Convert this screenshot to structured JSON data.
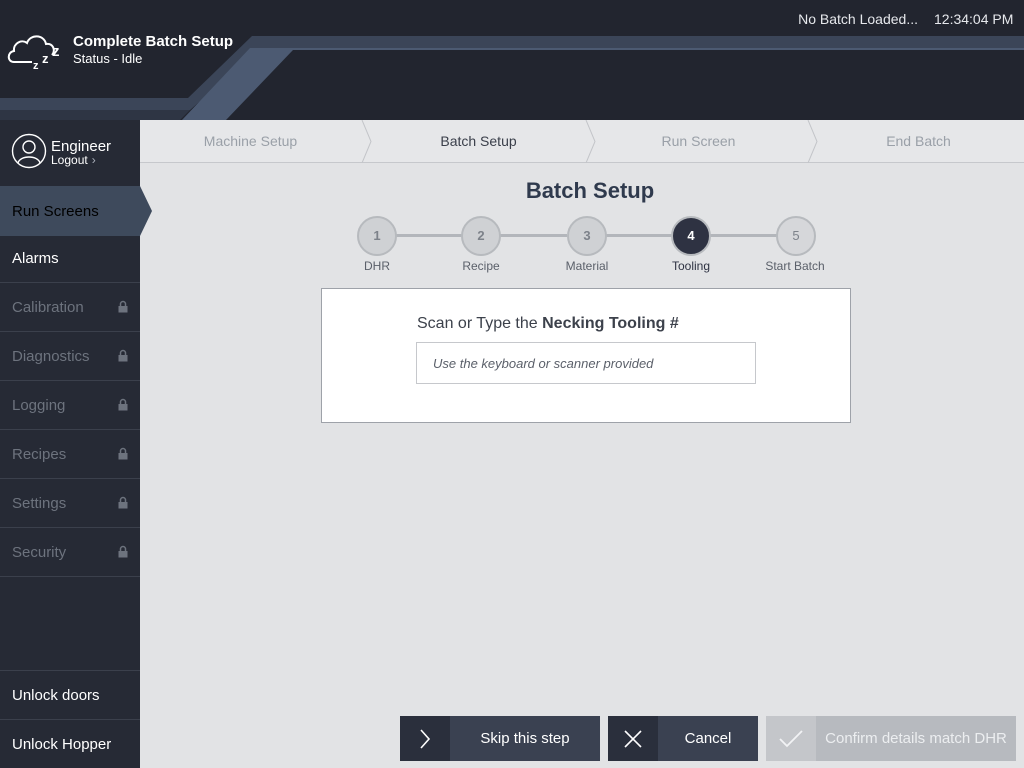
{
  "header": {
    "app_title": "Complete Batch Setup",
    "status": "Status - Idle",
    "batch_status": "No Batch Loaded...",
    "clock": "12:34:04 PM",
    "accent_color": "#4c5a72"
  },
  "user": {
    "name": "Engineer",
    "logout_label": "Logout"
  },
  "sidebar": {
    "items": [
      {
        "label": "Run Screens",
        "state": "active",
        "locked": false
      },
      {
        "label": "Alarms",
        "state": "enabled",
        "locked": false
      },
      {
        "label": "Calibration",
        "state": "disabled",
        "locked": true
      },
      {
        "label": "Diagnostics",
        "state": "disabled",
        "locked": true
      },
      {
        "label": "Logging",
        "state": "disabled",
        "locked": true
      },
      {
        "label": "Recipes",
        "state": "disabled",
        "locked": true
      },
      {
        "label": "Settings",
        "state": "disabled",
        "locked": true
      },
      {
        "label": "Security",
        "state": "disabled",
        "locked": true
      }
    ],
    "bottom": {
      "unlock_doors": "Unlock doors",
      "unlock_hopper": "Unlock Hopper"
    }
  },
  "breadcrumbs": {
    "items": [
      "Machine Setup",
      "Batch Setup",
      "Run Screen",
      "End Batch"
    ],
    "current": "Batch Setup"
  },
  "main": {
    "title": "Batch Setup",
    "steps": [
      {
        "number": "1",
        "label": "DHR",
        "status": "done"
      },
      {
        "number": "2",
        "label": "Recipe",
        "status": "done"
      },
      {
        "number": "3",
        "label": "Material",
        "status": "done"
      },
      {
        "number": "4",
        "label": "Tooling",
        "status": "active"
      },
      {
        "number": "5",
        "label": "Start Batch",
        "status": "future"
      }
    ],
    "prompt_prefix": "Scan or Type the ",
    "prompt_emphasis": "Necking Tooling #",
    "input_placeholder": "Use the keyboard or scanner provided",
    "input_value": ""
  },
  "actions": {
    "skip_label": "Skip this step",
    "cancel_label": "Cancel",
    "confirm_label": "Confirm details match DHR",
    "confirm_enabled": false
  },
  "icons": {
    "logo": "sleeping-cloud-icon",
    "user": "user-avatar-icon",
    "lock": "lock-icon",
    "skip": "chevron-right-icon",
    "cancel": "close-icon",
    "confirm": "check-icon"
  }
}
